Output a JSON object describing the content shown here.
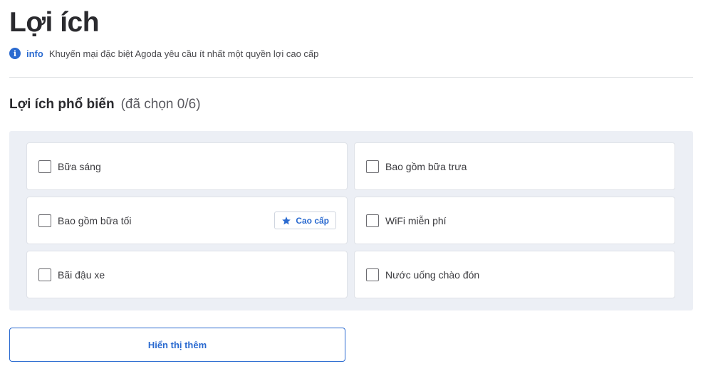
{
  "header": {
    "title": "Lợi ích"
  },
  "info": {
    "icon": "info-icon",
    "tag": "info",
    "text": "Khuyến mại đặc biệt Agoda yêu cầu ít nhất một quyền lợi cao cấp"
  },
  "section": {
    "title": "Lợi ích phổ biến",
    "count": "(đã chọn 0/6)"
  },
  "options": [
    {
      "label": "Bữa sáng",
      "checked": false
    },
    {
      "label": "Bao gồm bữa trưa",
      "checked": false
    },
    {
      "label": "Bao gồm bữa tối",
      "checked": false,
      "badge": "Cao cấp"
    },
    {
      "label": "WiFi miễn phí",
      "checked": false
    },
    {
      "label": "Bãi đậu xe",
      "checked": false
    },
    {
      "label": "Nước uống chào đón",
      "checked": false
    }
  ],
  "more_button": {
    "label": "Hiển thị thêm"
  },
  "colors": {
    "accent": "#2a6ad0",
    "panel_bg": "#eceff5",
    "text": "#2a2a2e"
  }
}
